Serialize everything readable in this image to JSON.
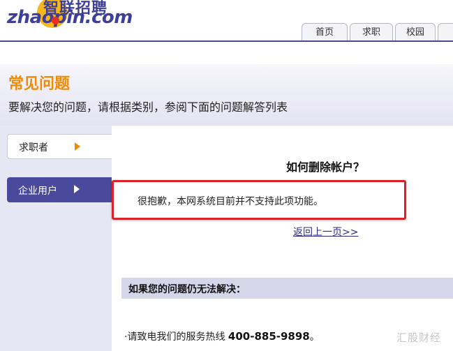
{
  "logo": {
    "cn": "智联招聘",
    "en": "zhaopin.com",
    "brand_color": "#3d3f99",
    "ball_color": "#f6b81c",
    "dot_color": "#e8311c"
  },
  "nav": {
    "tabs": [
      "首页",
      "求职",
      "校园"
    ]
  },
  "page": {
    "title": "常见问题",
    "subtitle": "要解决您的问题，请根据类别，参阅下面的问题解答列表"
  },
  "sidebar": {
    "items": [
      {
        "label": "求职者",
        "active": false
      },
      {
        "label": "企业用户",
        "active": true
      }
    ]
  },
  "question": {
    "title": "如何删除帐户？",
    "answer": "很抱歉，本网系统目前并不支持此项功能。",
    "back_link": "返回上一页>>"
  },
  "help": {
    "heading": "如果您的问题仍无法解决：",
    "hotline_prefix": "·请致电我们的服务热线",
    "hotline_number": "400-885-9898",
    "hotline_suffix": "。"
  },
  "watermark": "汇股财经",
  "colors": {
    "accent_orange": "#f08a00",
    "sidebar_active": "#4a4a9c",
    "highlight_red": "#d9232a"
  }
}
